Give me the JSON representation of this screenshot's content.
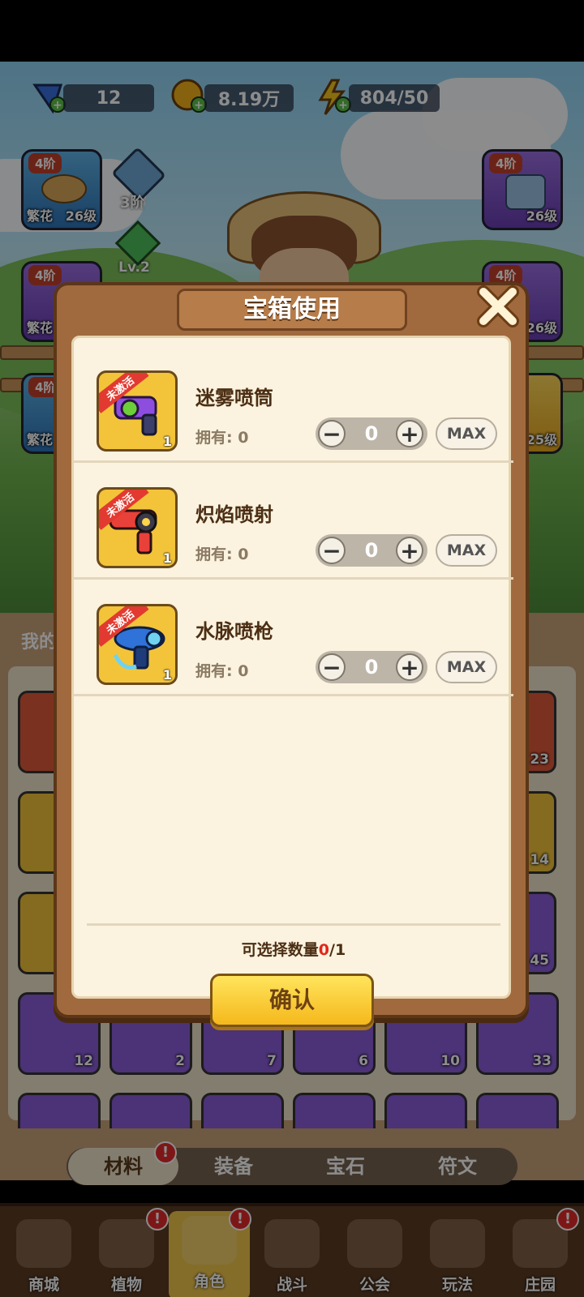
{
  "resources": [
    {
      "name": "gem",
      "value": "12",
      "color": "#3a6fe0"
    },
    {
      "name": "coin",
      "value": "8.19万",
      "color": "#f4b21c"
    },
    {
      "name": "energy",
      "value": "804/50",
      "color": "#f6c61e"
    }
  ],
  "equipment": {
    "left": [
      {
        "tier": "4阶",
        "label": "繁花",
        "level": "26级",
        "icon": "straw-hat-icon"
      },
      {
        "tier": "4阶",
        "label": "繁花",
        "icon": "armor-icon"
      },
      {
        "tier": "4阶",
        "label": "繁花",
        "icon": "boots-icon"
      }
    ],
    "right": [
      {
        "tier": "4阶",
        "level": "26级",
        "icon": "jacket-icon"
      },
      {
        "tier": "4阶",
        "level": "26级",
        "icon": "belt-icon"
      },
      {
        "level": "25级",
        "icon": "glove-icon"
      }
    ],
    "middle": [
      {
        "label": "3阶",
        "icon": "crate-icon"
      },
      {
        "label": "Lv.2",
        "icon": "green-gem-icon"
      }
    ]
  },
  "my_label": "我的",
  "inventory_counts": [
    "12",
    "2",
    "7",
    "6",
    "10",
    "33"
  ],
  "inventory_side_counts": [
    "23",
    "14",
    "45"
  ],
  "dialog": {
    "title": "宝箱使用",
    "inactive_badge": "未激活",
    "owned_prefix": "拥有: ",
    "max_label": "MAX",
    "minus": "−",
    "plus": "+",
    "items": [
      {
        "name": "迷雾喷筒",
        "owned": "0",
        "qty": "0",
        "count": "1",
        "icon": "purple-sprayer-icon"
      },
      {
        "name": "炽焰喷射",
        "owned": "0",
        "qty": "0",
        "count": "1",
        "icon": "red-flamethrower-icon"
      },
      {
        "name": "水脉喷枪",
        "owned": "0",
        "qty": "0",
        "count": "1",
        "icon": "blue-water-gun-icon"
      }
    ],
    "selectable_label": "可选择数量",
    "selected": "0",
    "selectable_max": "/1",
    "confirm_label": "确认"
  },
  "tabs": [
    "材料",
    "装备",
    "宝石",
    "符文"
  ],
  "tab_badge": "!",
  "nav": [
    {
      "label": "商城",
      "icon": "shop-icon",
      "badge": false
    },
    {
      "label": "植物",
      "icon": "plant-icon",
      "badge": true
    },
    {
      "label": "角色",
      "icon": "character-icon",
      "badge": true,
      "active": true
    },
    {
      "label": "战斗",
      "icon": "battle-icon",
      "badge": false
    },
    {
      "label": "公会",
      "icon": "guild-icon",
      "badge": false
    },
    {
      "label": "玩法",
      "icon": "gameplay-icon",
      "badge": false
    },
    {
      "label": "庄园",
      "icon": "manor-icon",
      "badge": true
    }
  ]
}
